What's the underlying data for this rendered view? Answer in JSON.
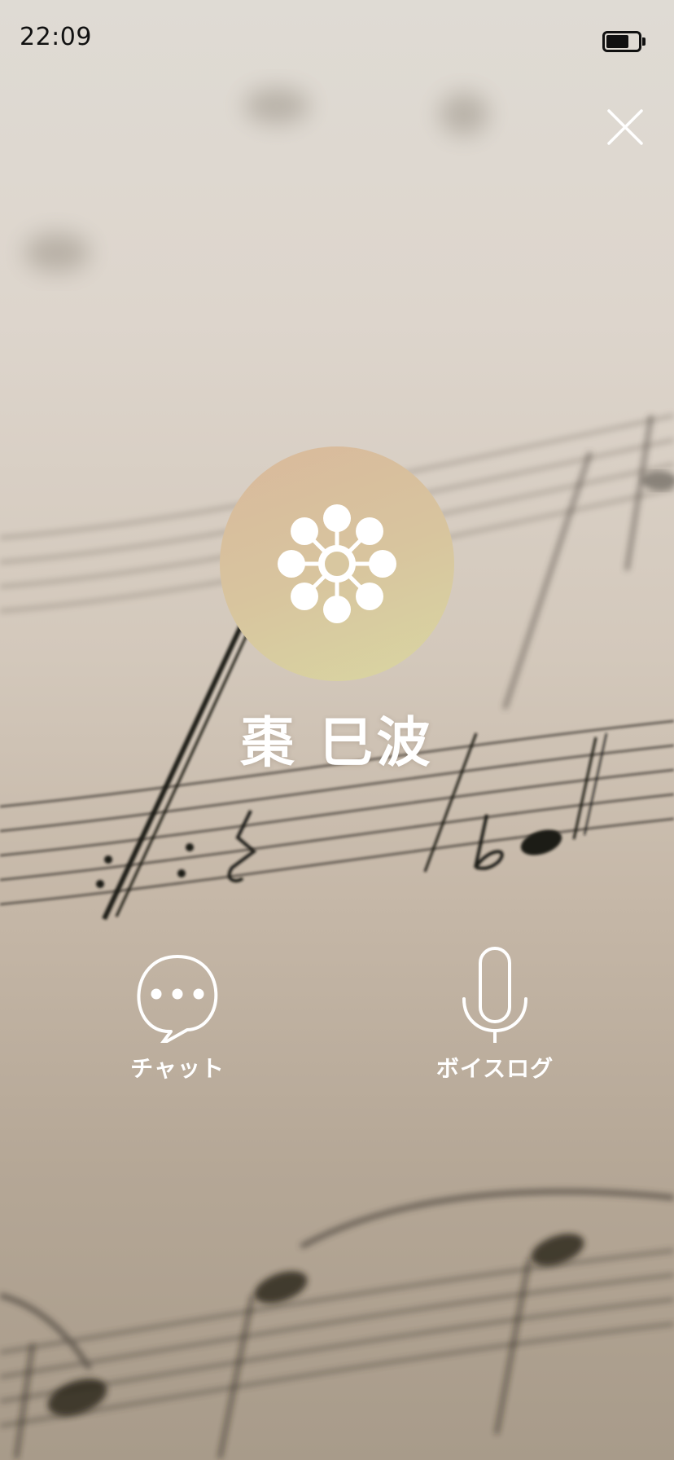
{
  "status_bar": {
    "time": "22:09",
    "battery_icon": "battery-icon"
  },
  "header": {
    "close_icon": "close-icon"
  },
  "profile": {
    "avatar_icon": "flower-dots-icon",
    "name": "棗 巳波"
  },
  "actions": [
    {
      "label": "チャット",
      "icon": "speech-bubble-icon"
    },
    {
      "label": "ボイスログ",
      "icon": "microphone-icon"
    }
  ],
  "colors": {
    "text_primary": "#ffffff",
    "status_text": "#111111",
    "avatar_gradient_start": "#d9b99c",
    "avatar_gradient_end": "#d9d6a2"
  }
}
